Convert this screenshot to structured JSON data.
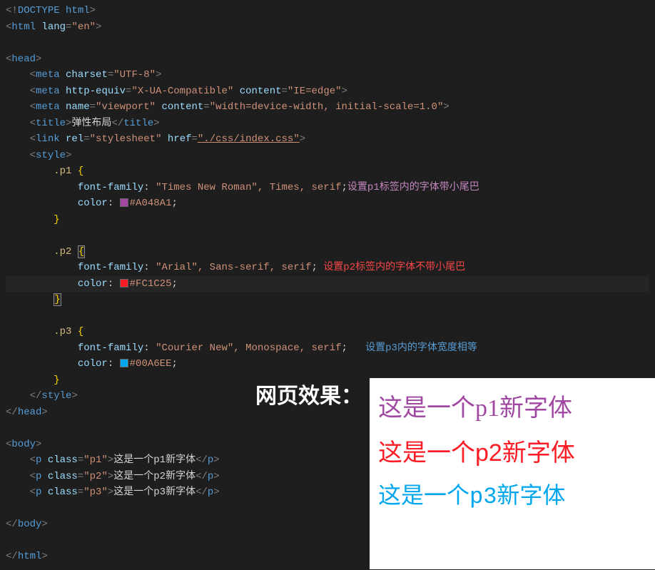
{
  "code": {
    "doctype": "DOCTYPE html",
    "html_attr_name": "lang",
    "html_attr_val": "\"en\"",
    "head": "head",
    "meta1_attr": "charset",
    "meta1_val": "\"UTF-8\"",
    "meta2_attr1": "http-equiv",
    "meta2_val1": "\"X-UA-Compatible\"",
    "meta2_attr2": "content",
    "meta2_val2": "\"IE=edge\"",
    "meta3_attr1": "name",
    "meta3_val1": "\"viewport\"",
    "meta3_attr2": "content",
    "meta3_val2": "\"width=device-width, initial-scale=1.0\"",
    "title_tag": "title",
    "title_text": "弹性布局",
    "link_attr1": "rel",
    "link_val1": "\"stylesheet\"",
    "link_attr2": "href",
    "link_val2": "\"./css/index.css\"",
    "style_tag": "style",
    "p1_sel": ".p1",
    "p1_ff": "font-family",
    "p1_ff_val": "\"Times New Roman\", Times, serif",
    "p1_comment": "设置p1标签内的字体带小尾巴",
    "p1_color_prop": "color",
    "p1_color_val": "#A048A1",
    "p2_sel": ".p2",
    "p2_ff": "font-family",
    "p2_ff_val": "\"Arial\", Sans-serif, serif",
    "p2_comment": "设置p2标签内的字体不带小尾巴",
    "p2_color_prop": "color",
    "p2_color_val": "#FC1C25",
    "p3_sel": ".p3",
    "p3_ff": "font-family",
    "p3_ff_val": "\"Courier New\", Monospace, serif",
    "p3_comment": "设置p3内的字体宽度相等",
    "p3_color_prop": "color",
    "p3_color_val": "#00A6EE",
    "body_tag": "body",
    "p_tag": "p",
    "class_attr": "class",
    "p1_class": "\"p1\"",
    "p2_class": "\"p2\"",
    "p3_class": "\"p3\"",
    "p1_body_text": "这是一个p1新字体",
    "p2_body_text": "这是一个p2新字体",
    "p3_body_text": "这是一个p3新字体",
    "html_tag": "html",
    "meta_tag": "meta",
    "link_tag": "link"
  },
  "preview": {
    "label": "网页效果：",
    "p1": "这是一个p1新字体",
    "p2": "这是一个p2新字体",
    "p3": "这是一个p3新字体"
  }
}
